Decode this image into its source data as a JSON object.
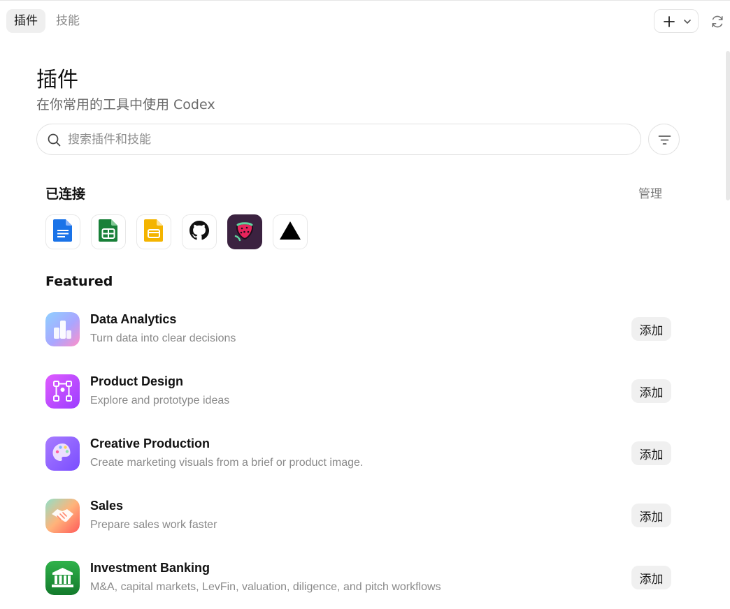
{
  "tabs": [
    {
      "label": "插件",
      "active": true
    },
    {
      "label": "技能",
      "active": false
    }
  ],
  "header": {
    "title": "插件",
    "subtitle": "在你常用的工具中使用 Codex"
  },
  "search": {
    "placeholder": "搜索插件和技能",
    "value": ""
  },
  "connected": {
    "title": "已连接",
    "manage_label": "管理",
    "apps": [
      {
        "icon": "google-docs-icon",
        "color": "#1a73e8"
      },
      {
        "icon": "google-sheets-icon",
        "color": "#188038"
      },
      {
        "icon": "google-slides-icon",
        "color": "#f4b400"
      },
      {
        "icon": "github-icon",
        "color": "#111111"
      },
      {
        "icon": "strawberry-app-icon",
        "color": "#3b2240"
      },
      {
        "icon": "vercel-icon",
        "color": "#000000"
      }
    ]
  },
  "featured": {
    "title": "Featured",
    "add_label": "添加",
    "items": [
      {
        "name": "Data Analytics",
        "desc": "Turn data into clear decisions",
        "icon": "bar-chart-icon"
      },
      {
        "name": "Product Design",
        "desc": "Explore and prototype ideas",
        "icon": "flow-diagram-icon"
      },
      {
        "name": "Creative Production",
        "desc": "Create marketing visuals from a brief or product image.",
        "icon": "palette-icon"
      },
      {
        "name": "Sales",
        "desc": "Prepare sales work faster",
        "icon": "handshake-icon"
      },
      {
        "name": "Investment Banking",
        "desc": "M&A, capital markets, LevFin, valuation, diligence, and pitch workflows",
        "icon": "bank-icon"
      }
    ]
  }
}
